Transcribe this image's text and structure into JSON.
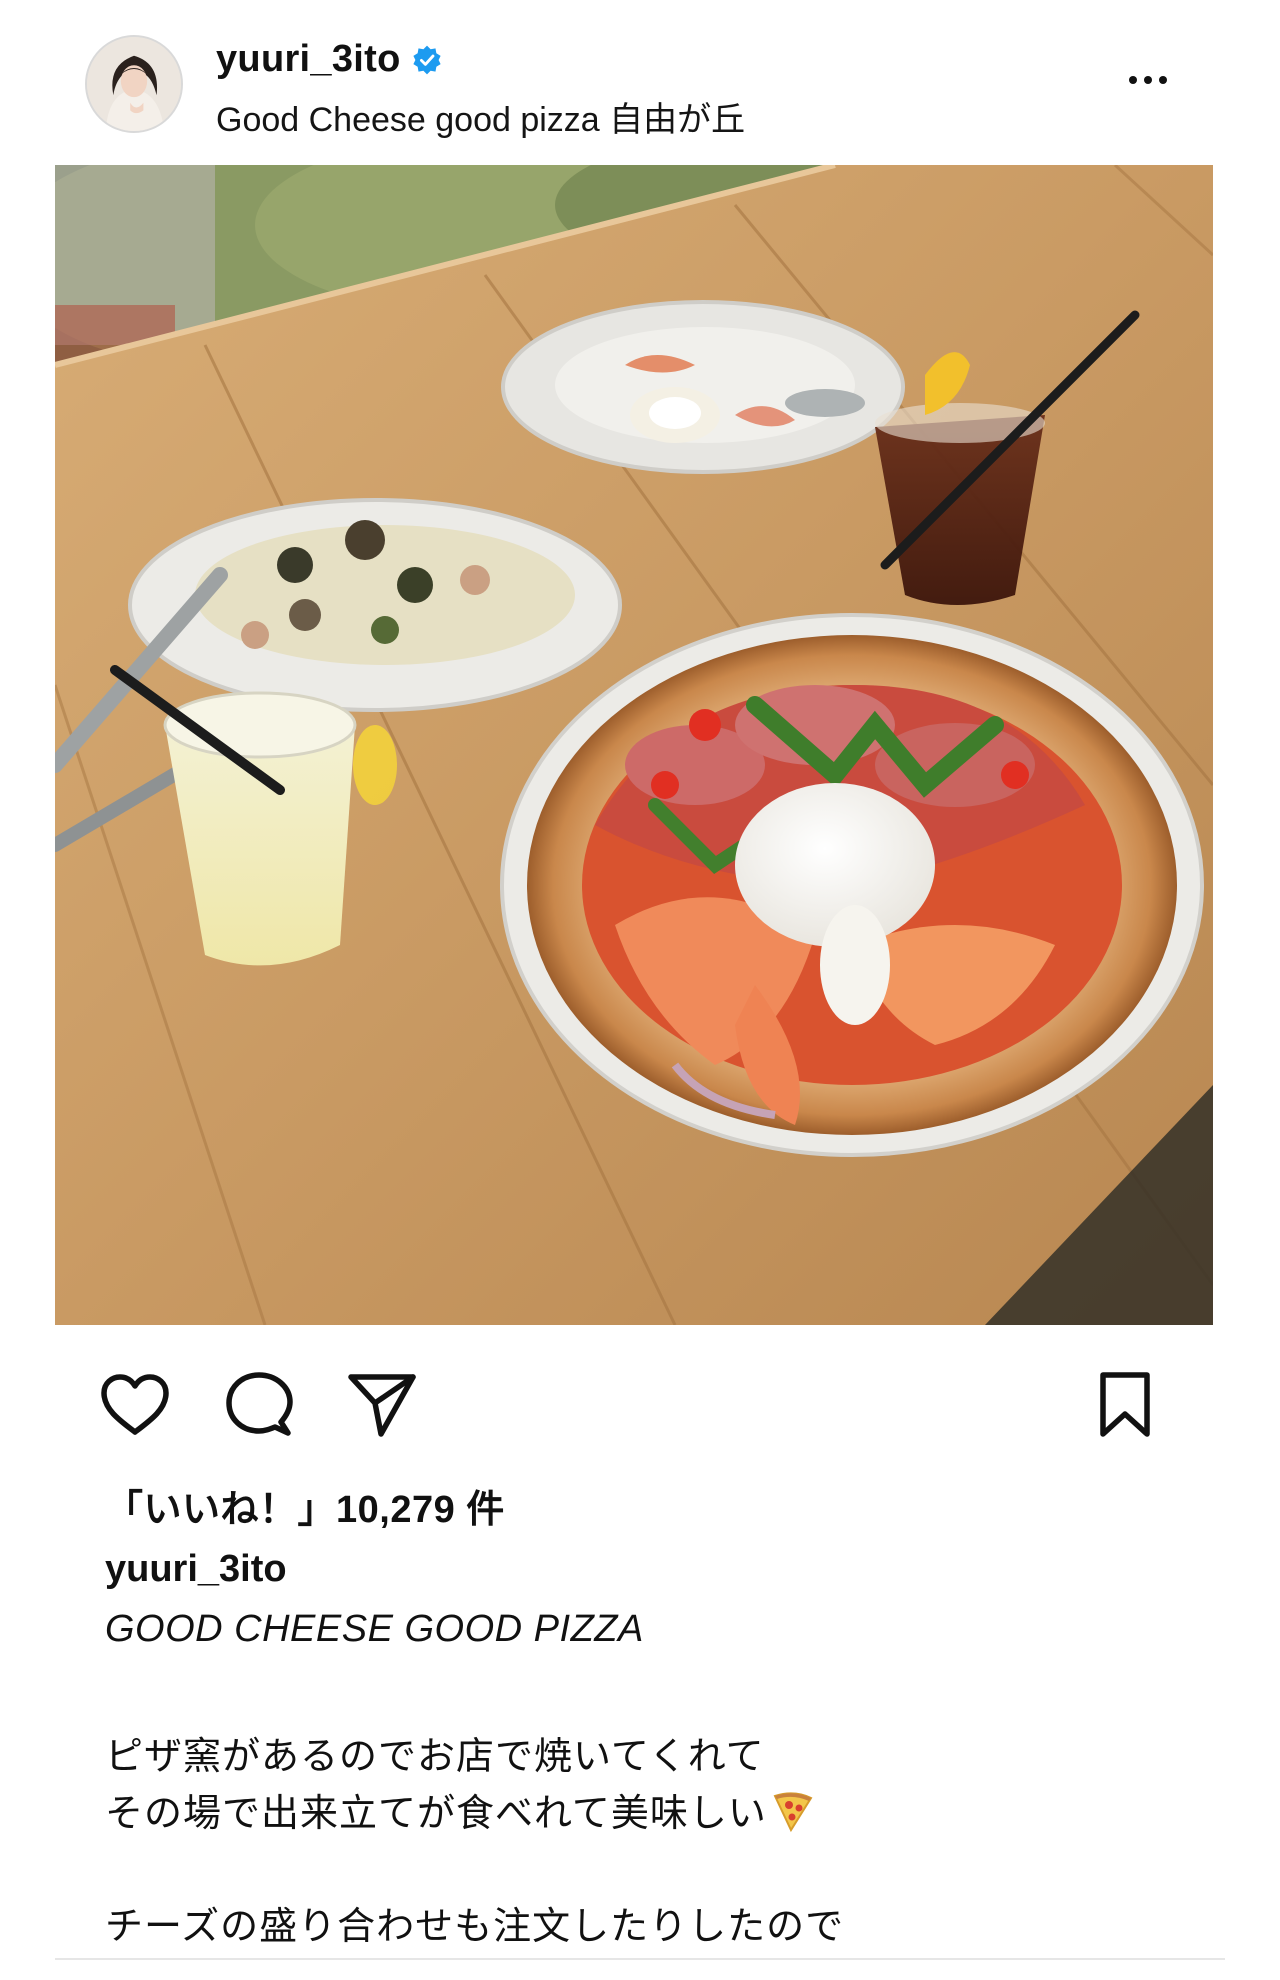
{
  "post": {
    "username": "yuuri_3ito",
    "verified": true,
    "location": "Good Cheese good pizza 自由が丘",
    "likes_text": "「いいね！」10,279 件",
    "caption": {
      "username": "yuuri_3ito",
      "title": "GOOD CHEESE GOOD PIZZA",
      "line1": "ピザ窯があるのでお店で焼いてくれて",
      "line2": "その場で出来立てが食べれて美味しい",
      "line2_emoji": "pizza-emoji",
      "line3": "チーズの盛り合わせも注文したりしたので"
    }
  },
  "icons": {
    "more": "more-horizontal-icon",
    "like": "heart-icon",
    "comment": "comment-bubble-icon",
    "share": "paper-plane-icon",
    "bookmark": "bookmark-icon",
    "verified": "verified-badge-icon"
  },
  "colors": {
    "verified_blue": "#1d9bf0",
    "text": "#111111",
    "table_wood": "#c99a63"
  }
}
